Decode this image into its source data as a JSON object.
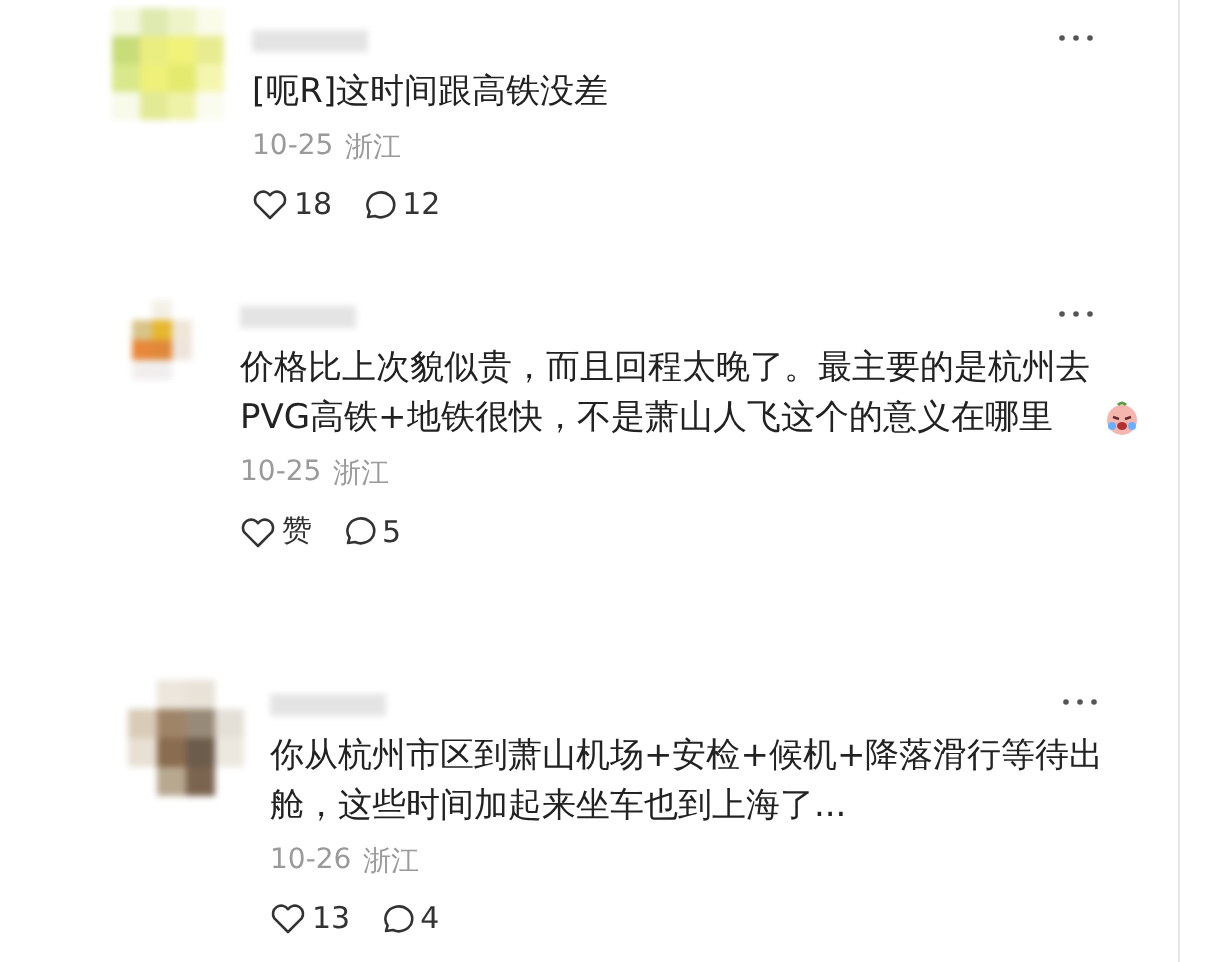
{
  "comments": [
    {
      "text": "[呃R]这时间跟高铁没差",
      "emoji": false,
      "date": "10-25",
      "region": "浙江",
      "likes": "18",
      "replies": "12"
    },
    {
      "text": "价格比上次貌似贵，而且回程太晚了。最主要的是杭州去 PVG高铁+地铁很快，不是萧山人飞这个的意义在哪里",
      "emoji": true,
      "date": "10-25",
      "region": "浙江",
      "likes": "赞",
      "replies": "5"
    },
    {
      "text": "你从杭州市区到萧山机场+安检+候机+降落滑行等待出舱，这些时间加起来坐车也到上海了...",
      "emoji": false,
      "date": "10-26",
      "region": "浙江",
      "likes": "13",
      "replies": "4"
    }
  ]
}
